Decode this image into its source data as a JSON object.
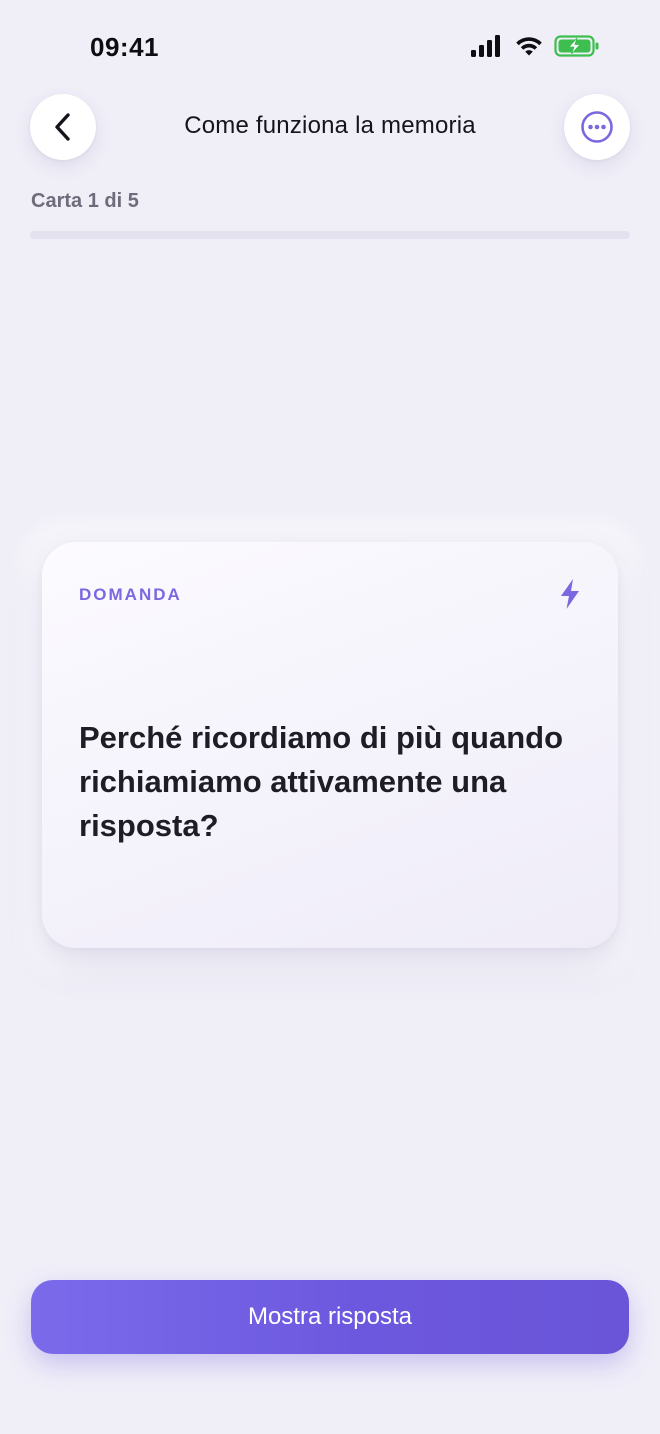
{
  "status_bar": {
    "time": "09:41",
    "icons": [
      "signal-icon",
      "wifi-icon",
      "battery-charging-icon"
    ],
    "battery_color": "#3DBE4E"
  },
  "header": {
    "title": "Come funziona la memoria",
    "back_icon": "chevron-left-icon",
    "more_icon": "ellipsis-circle-icon"
  },
  "progress": {
    "label": "Carta 1 di 5",
    "current": 1,
    "total": 5,
    "fill_fraction": 0
  },
  "card": {
    "tag": "DOMANDA",
    "icon": "bolt-icon",
    "question": "Perché ricordiamo di più quando richiamiamo attivamente una risposta?"
  },
  "actions": {
    "primary_label": "Mostra risposta"
  },
  "colors": {
    "accent": "#7A68E0",
    "background": "#F0EFF8",
    "button_gradient_start": "#7B6BEB",
    "button_gradient_end": "#6A55D8"
  }
}
